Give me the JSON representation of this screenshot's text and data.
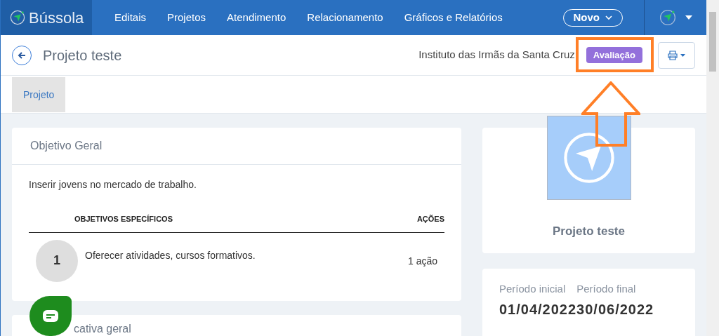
{
  "brand": "Bússola",
  "nav": [
    {
      "label": "Editais"
    },
    {
      "label": "Projetos"
    },
    {
      "label": "Atendimento"
    },
    {
      "label": "Relacionamento"
    },
    {
      "label": "Gráficos e Relatórios"
    }
  ],
  "new_button": "Novo",
  "header": {
    "title": "Projeto teste",
    "organization": "Instituto das Irmãs da Santa Cruz",
    "status": "Avaliação"
  },
  "tabs": [
    {
      "label": "Projeto",
      "selected": true
    }
  ],
  "general_objective": {
    "title": "Objetivo Geral",
    "text": "Inserir jovens no mercado de trabalho.",
    "columns": [
      "OBJETIVOS ESPECÍFICOS",
      "AÇÕES"
    ],
    "rows": [
      {
        "number": "1",
        "text": "Oferecer atividades, cursos formativos.",
        "actions": "1 ação"
      }
    ]
  },
  "justification": {
    "title": "cativa geral"
  },
  "project_card": {
    "name": "Projeto teste"
  },
  "period": {
    "start_label": "Período inicial",
    "end_label": "Período final",
    "start": "01/04/2022",
    "end": "30/06/2022"
  }
}
